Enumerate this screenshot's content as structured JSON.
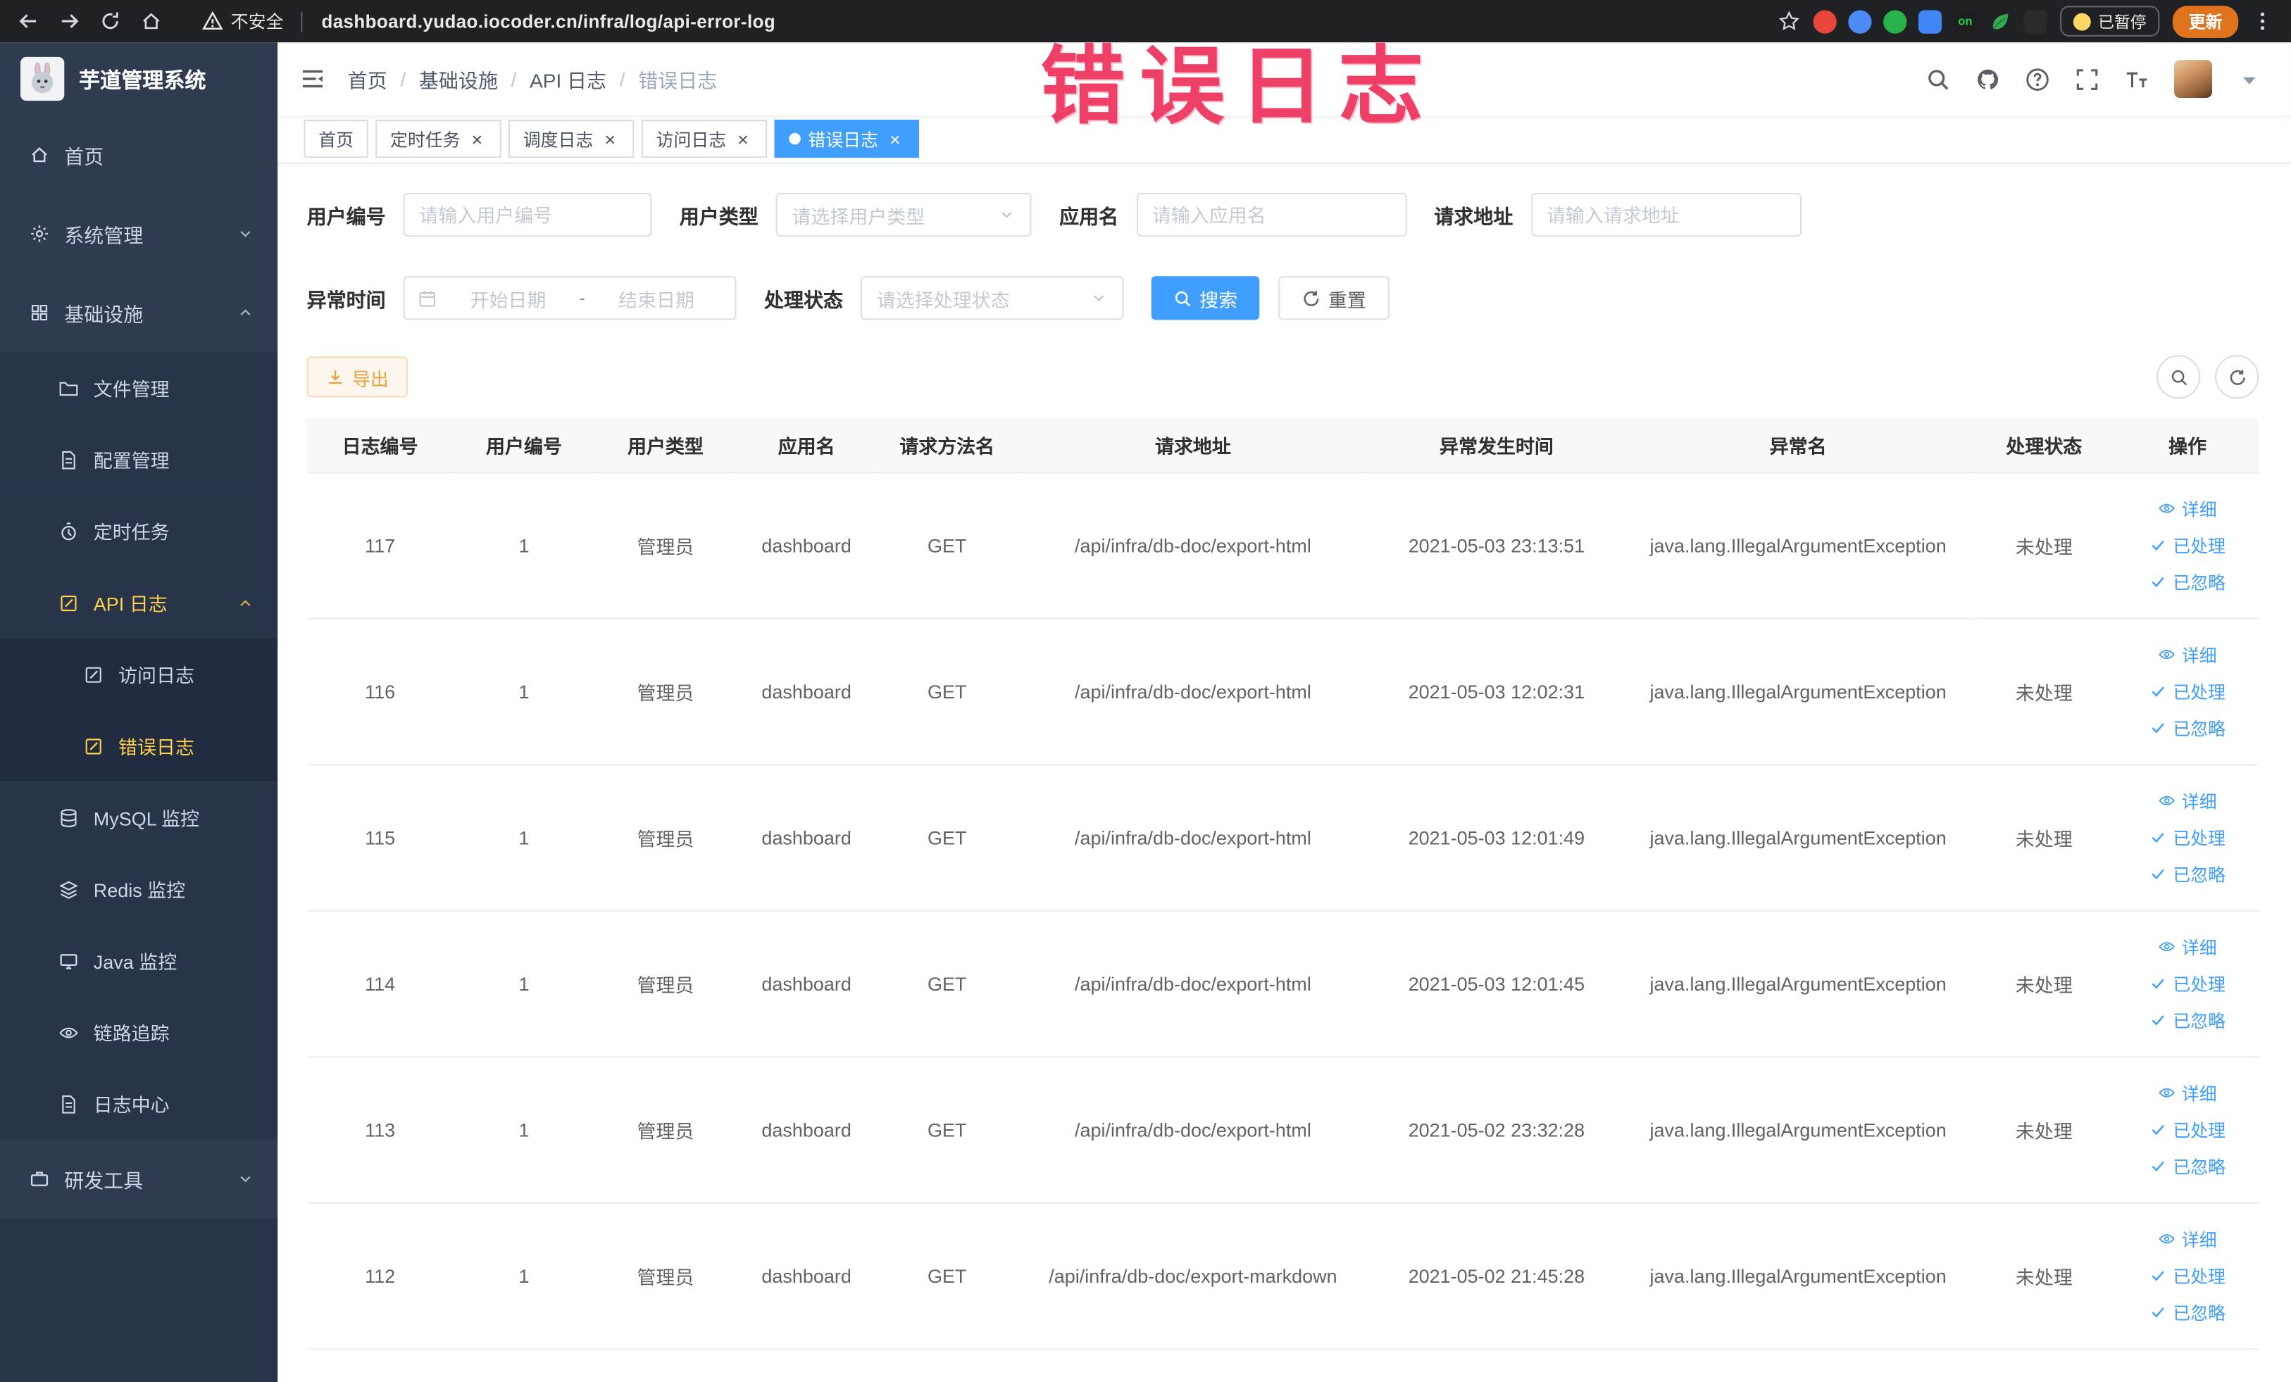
{
  "browser": {
    "security_text": "不安全",
    "url": "dashboard.yudao.iocoder.cn/infra/log/api-error-log",
    "paused_label": "已暂停",
    "update_label": "更新",
    "extensions": [
      {
        "name": "extension-red",
        "color": "#e8453c",
        "shape": "circle"
      },
      {
        "name": "extension-blue-drop",
        "color": "#4c8bf5",
        "shape": "circle"
      },
      {
        "name": "extension-green",
        "color": "#27b24a",
        "shape": "circle"
      },
      {
        "name": "extension-blue-grid",
        "color": "#4285f4",
        "shape": "square"
      },
      {
        "name": "extension-on-badge",
        "color": "#1e1e1e",
        "shape": "square",
        "text": "on",
        "text_color": "#2bd14d"
      },
      {
        "name": "extension-leaf",
        "color": "#34a853",
        "shape": "leaf"
      },
      {
        "name": "extension-dark",
        "color": "#2b2b2b",
        "shape": "square"
      }
    ]
  },
  "annotation": {
    "text": "错误日志",
    "color": "#ee3f66"
  },
  "sidebar": {
    "title": "芋道管理系统",
    "items": [
      {
        "name": "home",
        "label": "首页",
        "icon": "home",
        "level": 1
      },
      {
        "name": "system-management",
        "label": "系统管理",
        "icon": "gear",
        "level": 1,
        "chevron": "down"
      },
      {
        "name": "infrastructure",
        "label": "基础设施",
        "icon": "grid",
        "level": 1,
        "chevron": "up"
      },
      {
        "name": "file-management",
        "label": "文件管理",
        "icon": "folder",
        "level": 2
      },
      {
        "name": "config-management",
        "label": "配置管理",
        "icon": "doc",
        "level": 2
      },
      {
        "name": "scheduled-jobs",
        "label": "定时任务",
        "icon": "timer",
        "level": 2
      },
      {
        "name": "api-log",
        "label": "API 日志",
        "icon": "edit",
        "level": 2,
        "chevron": "up",
        "active": true
      },
      {
        "name": "access-log",
        "label": "访问日志",
        "icon": "edit",
        "level": 3
      },
      {
        "name": "error-log",
        "label": "错误日志",
        "icon": "edit",
        "level": 3,
        "active": true
      },
      {
        "name": "mysql-monitor",
        "label": "MySQL 监控",
        "icon": "db",
        "level": 2
      },
      {
        "name": "redis-monitor",
        "label": "Redis 监控",
        "icon": "layers",
        "level": 2
      },
      {
        "name": "java-monitor",
        "label": "Java 监控",
        "icon": "monitor",
        "level": 2
      },
      {
        "name": "trace",
        "label": "链路追踪",
        "icon": "eye",
        "level": 2
      },
      {
        "name": "log-center",
        "label": "日志中心",
        "icon": "doc",
        "level": 2
      },
      {
        "name": "dev-tools",
        "label": "研发工具",
        "icon": "tools",
        "level": 1,
        "chevron": "down"
      }
    ]
  },
  "breadcrumb": [
    "首页",
    "基础设施",
    "API 日志",
    "错误日志"
  ],
  "tabs": [
    {
      "name": "home",
      "label": "首页",
      "closable": false,
      "active": false
    },
    {
      "name": "scheduled-jobs",
      "label": "定时任务",
      "closable": true,
      "active": false
    },
    {
      "name": "job-log",
      "label": "调度日志",
      "closable": true,
      "active": false
    },
    {
      "name": "access-log",
      "label": "访问日志",
      "closable": true,
      "active": false
    },
    {
      "name": "error-log",
      "label": "错误日志",
      "closable": true,
      "active": true
    }
  ],
  "filters": {
    "user_id_label": "用户编号",
    "user_id_placeholder": "请输入用户编号",
    "user_type_label": "用户类型",
    "user_type_placeholder": "请选择用户类型",
    "app_name_label": "应用名",
    "app_name_placeholder": "请输入应用名",
    "request_url_label": "请求地址",
    "request_url_placeholder": "请输入请求地址",
    "exception_time_label": "异常时间",
    "start_date_placeholder": "开始日期",
    "range_separator": "-",
    "end_date_placeholder": "结束日期",
    "process_status_label": "处理状态",
    "process_status_placeholder": "请选择处理状态",
    "search_label": "搜索",
    "reset_label": "重置"
  },
  "toolbar": {
    "export_label": "导出"
  },
  "table": {
    "columns": [
      "日志编号",
      "用户编号",
      "用户类型",
      "应用名",
      "请求方法名",
      "请求地址",
      "异常发生时间",
      "异常名",
      "处理状态",
      "操作"
    ],
    "actions": {
      "detail": "详细",
      "processed": "已处理",
      "ignored": "已忽略"
    },
    "rows": [
      {
        "id": "117",
        "user_id": "1",
        "user_type": "管理员",
        "app": "dashboard",
        "method": "GET",
        "url": "/api/infra/db-doc/export-html",
        "time": "2021-05-03 23:13:51",
        "exception": "java.lang.IllegalArgumentException",
        "status": "未处理"
      },
      {
        "id": "116",
        "user_id": "1",
        "user_type": "管理员",
        "app": "dashboard",
        "method": "GET",
        "url": "/api/infra/db-doc/export-html",
        "time": "2021-05-03 12:02:31",
        "exception": "java.lang.IllegalArgumentException",
        "status": "未处理"
      },
      {
        "id": "115",
        "user_id": "1",
        "user_type": "管理员",
        "app": "dashboard",
        "method": "GET",
        "url": "/api/infra/db-doc/export-html",
        "time": "2021-05-03 12:01:49",
        "exception": "java.lang.IllegalArgumentException",
        "status": "未处理"
      },
      {
        "id": "114",
        "user_id": "1",
        "user_type": "管理员",
        "app": "dashboard",
        "method": "GET",
        "url": "/api/infra/db-doc/export-html",
        "time": "2021-05-03 12:01:45",
        "exception": "java.lang.IllegalArgumentException",
        "status": "未处理"
      },
      {
        "id": "113",
        "user_id": "1",
        "user_type": "管理员",
        "app": "dashboard",
        "method": "GET",
        "url": "/api/infra/db-doc/export-html",
        "time": "2021-05-02 23:32:28",
        "exception": "java.lang.IllegalArgumentException",
        "status": "未处理"
      },
      {
        "id": "112",
        "user_id": "1",
        "user_type": "管理员",
        "app": "dashboard",
        "method": "GET",
        "url": "/api/infra/db-doc/export-markdown",
        "time": "2021-05-02 21:45:28",
        "exception": "java.lang.IllegalArgumentException",
        "status": "未处理"
      }
    ]
  },
  "colors": {
    "accent": "#409eff",
    "active_menu": "#ffd04b",
    "warning": "#e6a23c",
    "annotation": "#ee3f66"
  }
}
